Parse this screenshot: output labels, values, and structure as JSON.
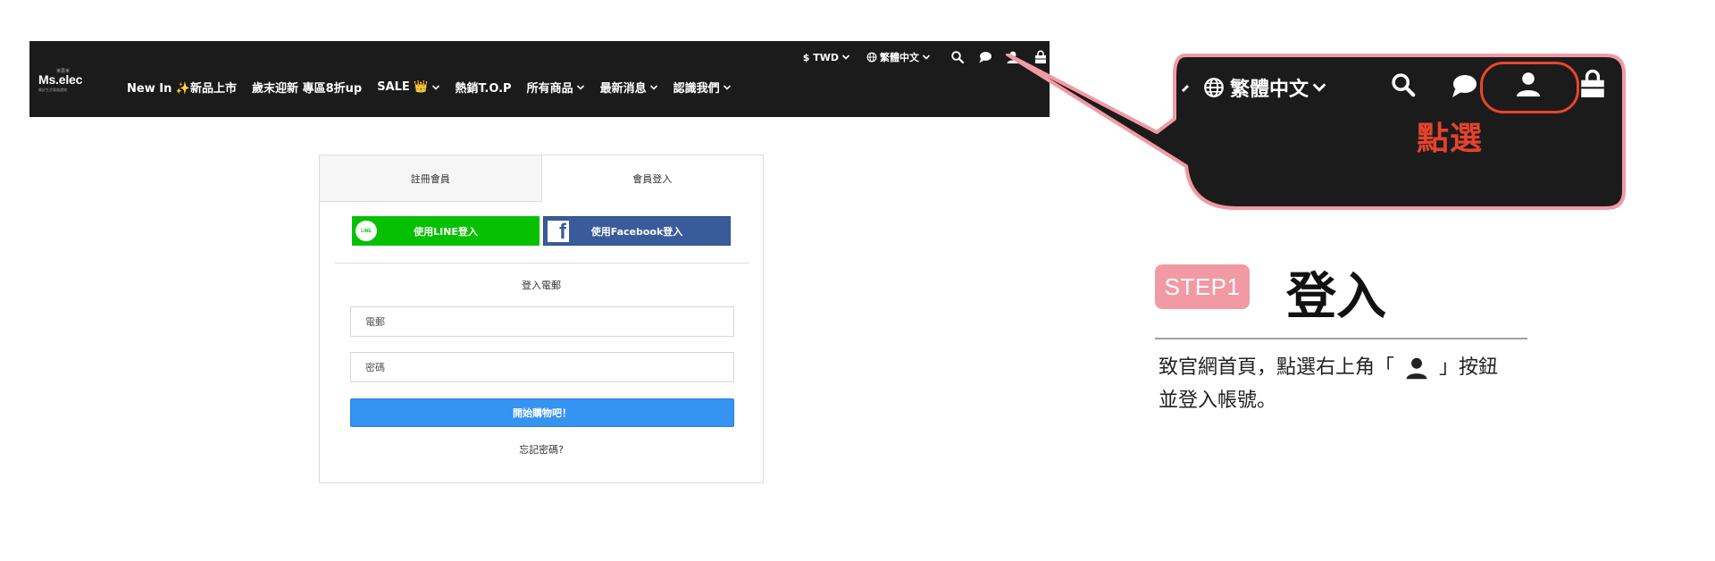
{
  "header": {
    "logo": {
      "text": "Ms.elec",
      "sub": "米思米",
      "tagline": "美好生活電器選物"
    },
    "utility": {
      "currency": "$ TWD",
      "language": "繁體中文"
    },
    "nav": [
      {
        "label": "New In ✨新品上市",
        "has_dropdown": false
      },
      {
        "label": "歲末迎新 專區8折up",
        "has_dropdown": false
      },
      {
        "label": "SALE 👑",
        "has_dropdown": true
      },
      {
        "label": "熱銷T.O.P",
        "has_dropdown": false
      },
      {
        "label": "所有商品",
        "has_dropdown": true
      },
      {
        "label": "最新消息",
        "has_dropdown": true
      },
      {
        "label": "認識我們",
        "has_dropdown": true
      }
    ],
    "icons": [
      "search-icon",
      "chat-icon",
      "user-icon",
      "shopping-bag-icon"
    ]
  },
  "login": {
    "tabs": [
      {
        "label": "註冊會員",
        "active": false
      },
      {
        "label": "會員登入",
        "active": true
      }
    ],
    "line_button": "使用LINE登入",
    "line_badge": "LINE",
    "facebook_button": "使用Facebook登入",
    "form_title": "登入電郵",
    "email_placeholder": "電郵",
    "password_placeholder": "密碼",
    "submit": "開始購物吧！",
    "forgot": "忘記密碼?"
  },
  "callout": {
    "language": "繁體中文",
    "click_label": "點選",
    "highlight_color": "#e8452b",
    "border_color": "#f29aa4",
    "bubble_color": "#1b1b1b"
  },
  "step": {
    "badge": "STEP1",
    "title": "登入",
    "desc_line1_before": "致官網首頁，點選右上角「",
    "desc_line1_after": "」按鈕",
    "desc_line2": "並登入帳號。"
  },
  "colors": {
    "header_bg": "#1b1b1b",
    "line_green": "#06c101",
    "facebook_blue": "#3a5b9b",
    "submit_blue": "#3593f1",
    "step_pink": "#f29aa4"
  }
}
